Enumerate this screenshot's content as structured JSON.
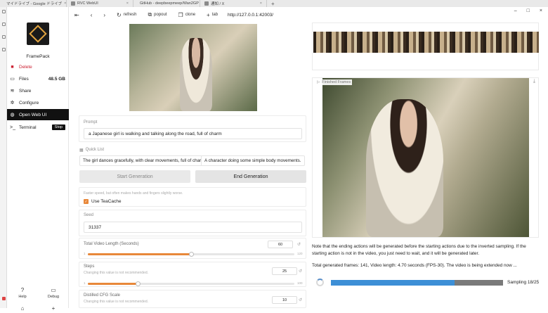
{
  "browser": {
    "tabs": [
      {
        "label": "マイドライブ - Google ドライブ"
      },
      {
        "label": "RVC WebUI"
      },
      {
        "label": "GitHub - deepbeepmeep/Wan2GP"
      },
      {
        "label": "通知 / X"
      }
    ],
    "new_tab": "+"
  },
  "toolbar": {
    "refresh": "refresh",
    "popout": "popout",
    "clone": "clone",
    "tab": "tab",
    "url": "http://127.0.0.1:42003/"
  },
  "app": {
    "name": "FramePack",
    "nav": {
      "delete": "Delete",
      "files": "Files",
      "files_size": "48.5 GB",
      "share": "Share",
      "configure": "Configure",
      "open_web_ui": "Open Web UI",
      "terminal": "Terminal",
      "stop": "Stop"
    },
    "bottom": {
      "help": "Help",
      "debug": "Debug"
    }
  },
  "form": {
    "prompt_label": "Prompt",
    "prompt_value": "a Japanese  girl is walking and talking along the road, full of charm",
    "quick_list_label": "Quick List",
    "quick_items": [
      "The girl dances gracefully, with clear movements, full of charm.",
      "A character doing some simple body movements."
    ],
    "start_button": "Start Generation",
    "end_button": "End Generation",
    "teacache_hint": "Faster speed, but often makes hands and fingers slightly worse.",
    "teacache_label": "Use TeaCache",
    "teacache_checked": true,
    "seed_label": "Seed",
    "seed_value": "31337",
    "video_length_label": "Total Video Length (Seconds)",
    "video_length_value": "60",
    "video_length_min": "1",
    "video_length_max": "120",
    "video_length_fraction": 0.5,
    "steps_label": "Steps",
    "steps_hint": "Changing this value is not recommended.",
    "steps_value": "25",
    "steps_min": "1",
    "steps_max": "100",
    "steps_fraction": 0.24,
    "cfg_label": "Distilled CFG Scale",
    "cfg_hint": "Changing this value is not recommended.",
    "cfg_value": "10"
  },
  "output": {
    "finished_label": "Finished Frames",
    "note": "Note that the ending actions will be generated before the starting actions due to the inverted sampling. If the starting action is not in the video, you just need to wait, and it will be generated later.",
    "status": "Total generated frames: 141, Video length: 4.70 seconds (FPS-30). The video is being extended now ...",
    "progress_text": "Sampling 18/25",
    "progress_fraction": 0.72
  },
  "colors": {
    "accent": "#e8883a",
    "progress": "#3d8fd6",
    "nav_active": "#111111"
  }
}
